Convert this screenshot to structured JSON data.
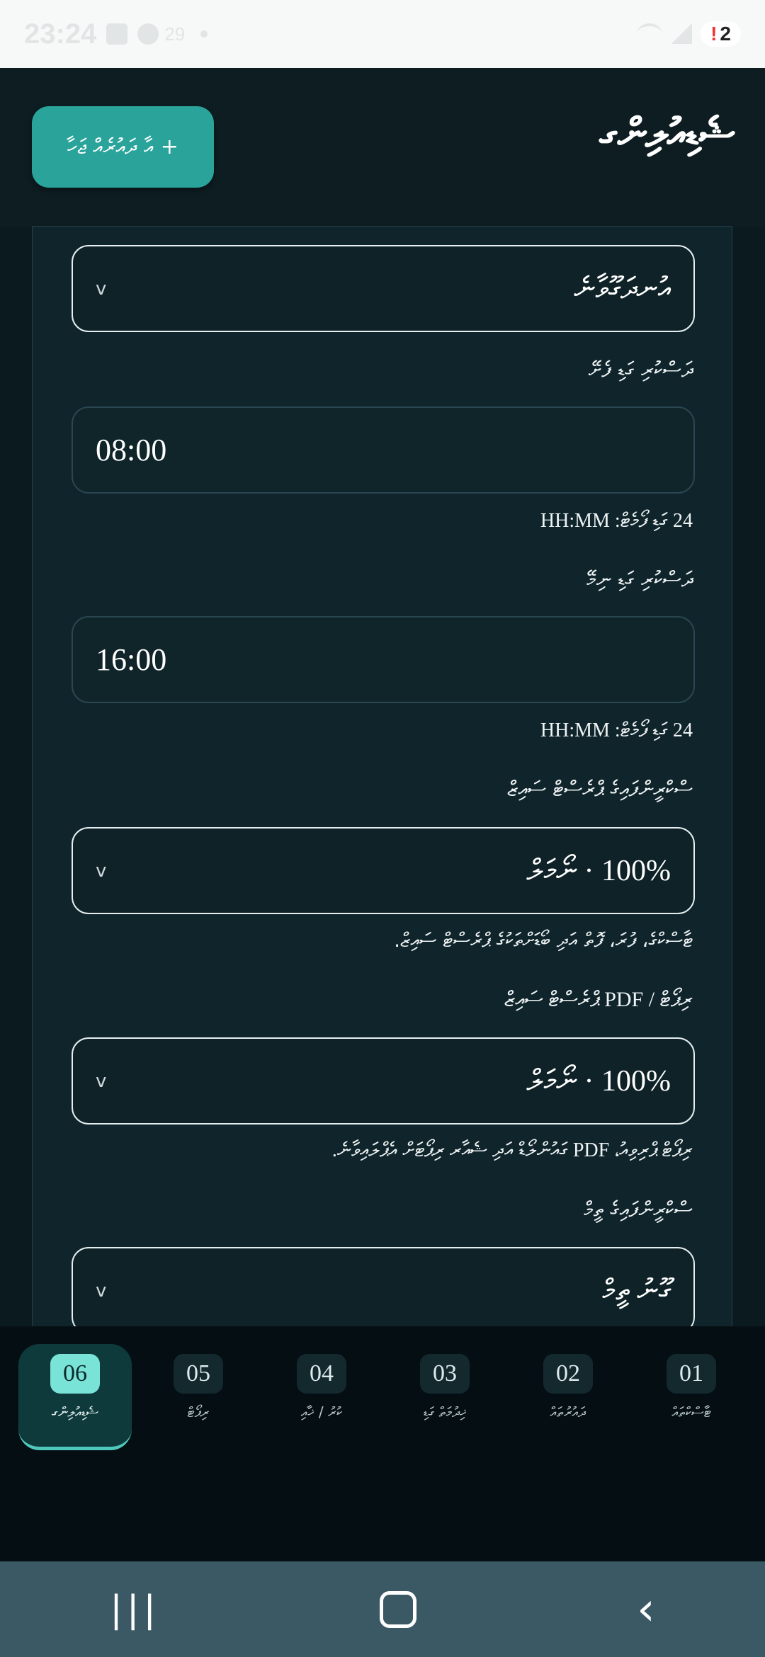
{
  "status_bar": {
    "time": "23:24",
    "temperature": "29",
    "notification_count": "2",
    "notification_mark": "!"
  },
  "header": {
    "title": "ޝެޑިއުލިންގ",
    "add_button_label": "+ އާ ދައުރެއް ޖަހާ"
  },
  "form": {
    "top_select_value": "އުނދަގޫވާނެ",
    "start_label": "ދަސްކުރި ގަޑި ފެށޭ",
    "start_value": "08:00",
    "start_help": "24 ގަޑި ފޯމެޓް: HH:MM",
    "end_label": "ދަސްކުރި ގަޑި ނިމޭ",
    "end_value": "16:00",
    "end_help": "24 ގަޑި ފޯމެޓް: HH:MM",
    "scale_label": "ސްކްރީންފައިގެ ޕްރެސްޓް ސައިޒް",
    "scale_value": "100% · ނޯމަލް",
    "scale_help": "ޓާސްކްގެ، ފުރަ، ފޮތް އަދި ބޯޑަށްތަކުގެ ޕްރެސްޓް ސައިޒް.",
    "pdf_label": "ރިޕޯޓް / PDF ޕްރެސްޓް ސައިޒް",
    "pdf_value": "100% · ނޯމަލް",
    "pdf_help": "ރިޕޯޓް ޕްރިވިއު، PDF ގައުންލޯޑް އަދި ޝެއާރ ރިޕޯޓަށް އެޕްލައިވާނެ.",
    "theme_label": "ސްކްރީންފައިގެ ތީމް",
    "theme_value": "ގޫނު ތީމް"
  },
  "steps": [
    {
      "num": "06",
      "label": "ޝެޑިއުލިންގ",
      "active": true
    },
    {
      "num": "05",
      "label": "ރިޕޯޓް",
      "active": false
    },
    {
      "num": "04",
      "label": "ކުރު / ޚާއި",
      "active": false
    },
    {
      "num": "03",
      "label": "ޚިދުމަތް ގަޑި",
      "active": false
    },
    {
      "num": "02",
      "label": "ދައުރުތައް",
      "active": false
    },
    {
      "num": "01",
      "label": "ޓާސްކްތައް",
      "active": false
    }
  ],
  "colors": {
    "accent": "#2aa49b",
    "active_step": "#7ae3d7",
    "background": "#0b1a1e"
  }
}
